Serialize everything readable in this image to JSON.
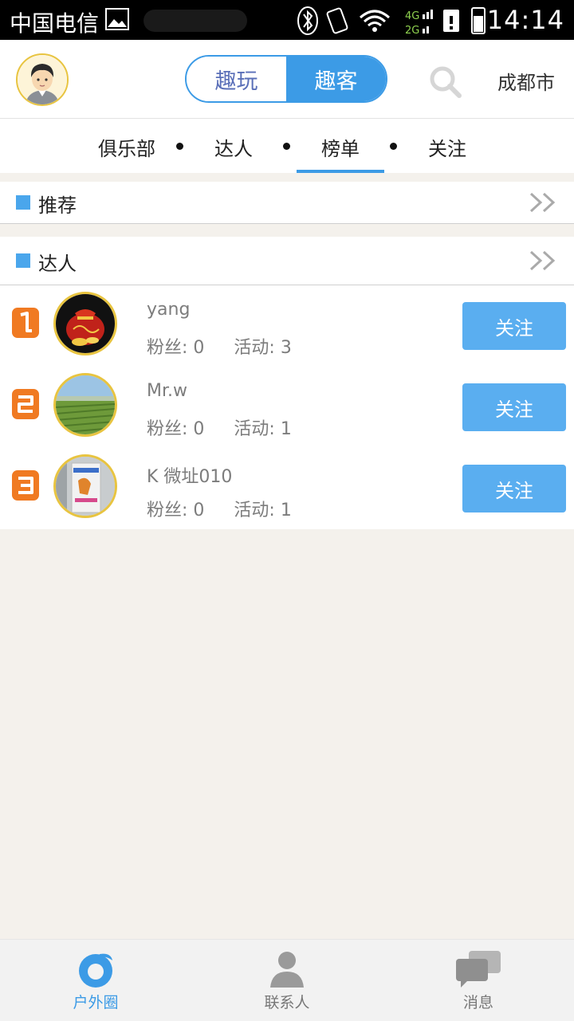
{
  "status_bar": {
    "carrier": "中国电信",
    "network_top": "4G",
    "network_bottom": "2G",
    "time": "14:14"
  },
  "header": {
    "segments": [
      {
        "label": "趣玩",
        "active": false
      },
      {
        "label": "趣客",
        "active": true
      }
    ],
    "city": "成都市"
  },
  "tabs": [
    {
      "label": "俱乐部",
      "active": false
    },
    {
      "label": "达人",
      "active": false
    },
    {
      "label": "榜单",
      "active": true
    },
    {
      "label": "关注",
      "active": false
    }
  ],
  "sections": {
    "recommend": {
      "title": "推荐"
    },
    "experts": {
      "title": "达人"
    }
  },
  "ranking": {
    "fans_label": "粉丝:",
    "activity_label": "活动:",
    "follow_label": "关注",
    "rows": [
      {
        "rank": "1",
        "name": "yang",
        "fans": "0",
        "activities": "3"
      },
      {
        "rank": "2",
        "name": "Mr.w",
        "fans": "0",
        "activities": "1"
      },
      {
        "rank": "3",
        "name": "K 微址010",
        "fans": "0",
        "activities": "1"
      }
    ]
  },
  "bottom_nav": [
    {
      "label": "户外圈",
      "icon": "outdoor-circle-icon",
      "active": true
    },
    {
      "label": "联系人",
      "icon": "contacts-icon",
      "active": false
    },
    {
      "label": "消息",
      "icon": "messages-icon",
      "active": false
    }
  ],
  "colors": {
    "accent": "#3c9be6",
    "follow_button": "#5aaef0",
    "rank_badge": "#f07a22",
    "avatar_border": "#e8c440"
  }
}
